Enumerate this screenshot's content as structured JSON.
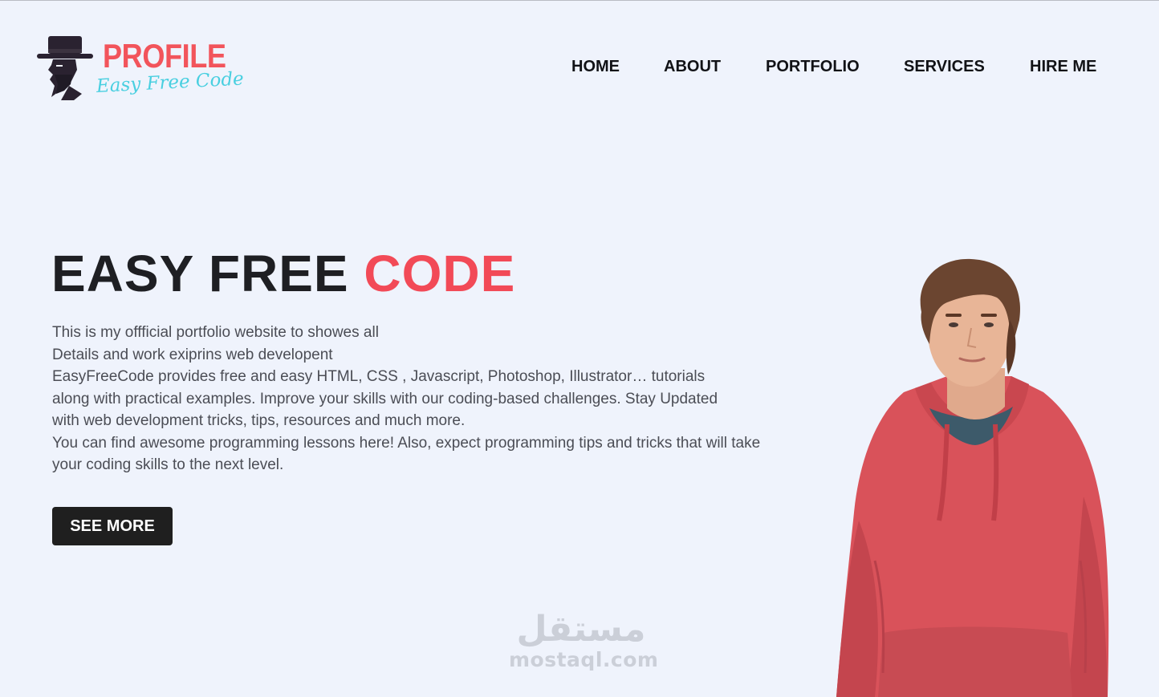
{
  "brand": {
    "title": "PROFILE",
    "subtitle": "Easy Free Code",
    "logo_icon": "gentleman-hat-icon",
    "colors": {
      "title": "#f2545b",
      "subtitle": "#49cfe0"
    }
  },
  "nav": {
    "items": [
      {
        "label": "HOME"
      },
      {
        "label": "ABOUT"
      },
      {
        "label": "PORTFOLIO"
      },
      {
        "label": "SERVICES"
      },
      {
        "label": "HIRE ME"
      }
    ]
  },
  "hero": {
    "title_main": "EASY FREE ",
    "title_accent": "CODE",
    "accent_color": "#f24a57",
    "paragraph_lines": [
      "This is my offficial portfolio website to showes all",
      "Details and work exiprins web developent",
      "EasyFreeCode provides free and easy HTML, CSS , Javascript, Photoshop, Illustrator… tutorials",
      "along with practical examples. Improve your skills with our coding-based challenges. Stay Updated",
      "with web development tricks, tips, resources and much more.",
      "You can find awesome programming lessons here! Also, expect programming tips and tricks that will take",
      "your coding skills to the next level."
    ],
    "button_label": "SEE MORE"
  },
  "watermark": {
    "arabic": "مستقل",
    "domain": "mostaql.com"
  },
  "colors": {
    "background": "#eff3fc",
    "button_bg": "#1f1f1f",
    "hoodie": "#d9525a"
  }
}
